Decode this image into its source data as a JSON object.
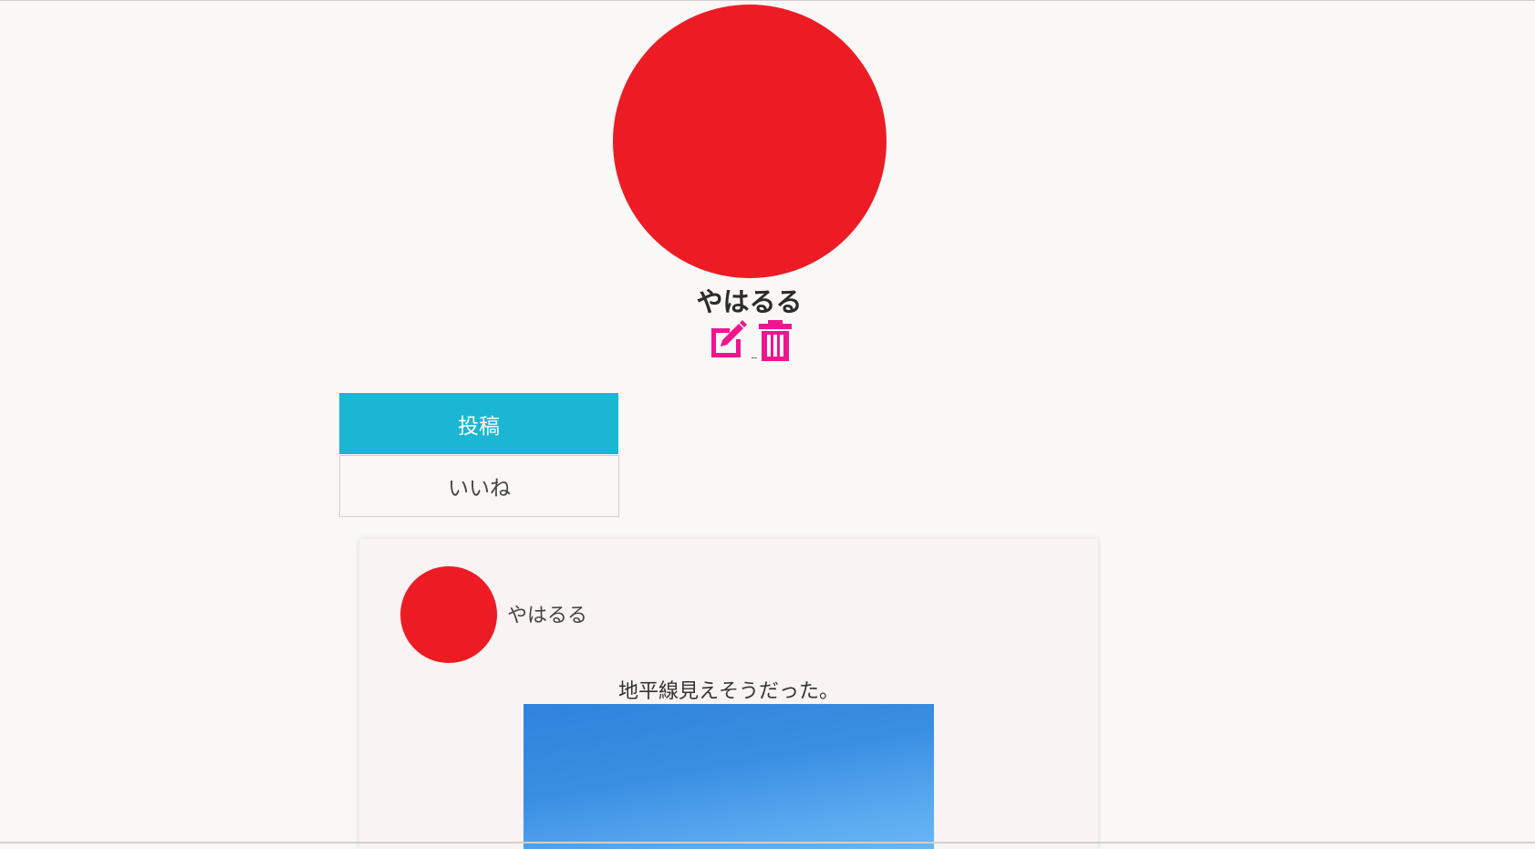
{
  "profile": {
    "name": "やはるる",
    "avatar_color": "#ed1c24",
    "actions": {
      "edit_icon": "edit-icon",
      "delete_icon": "trash-icon",
      "action_color": "#f0158f"
    }
  },
  "tabs": [
    {
      "label": "投稿",
      "active": true
    },
    {
      "label": "いいね",
      "active": false
    }
  ],
  "colors": {
    "accent": "#1bb6d3",
    "background": "#f9f8f6"
  },
  "post": {
    "author": "やはるる",
    "avatar_color": "#ed1c24",
    "text": "地平線見えそうだった。",
    "image_description_icon": "sky-photo"
  }
}
